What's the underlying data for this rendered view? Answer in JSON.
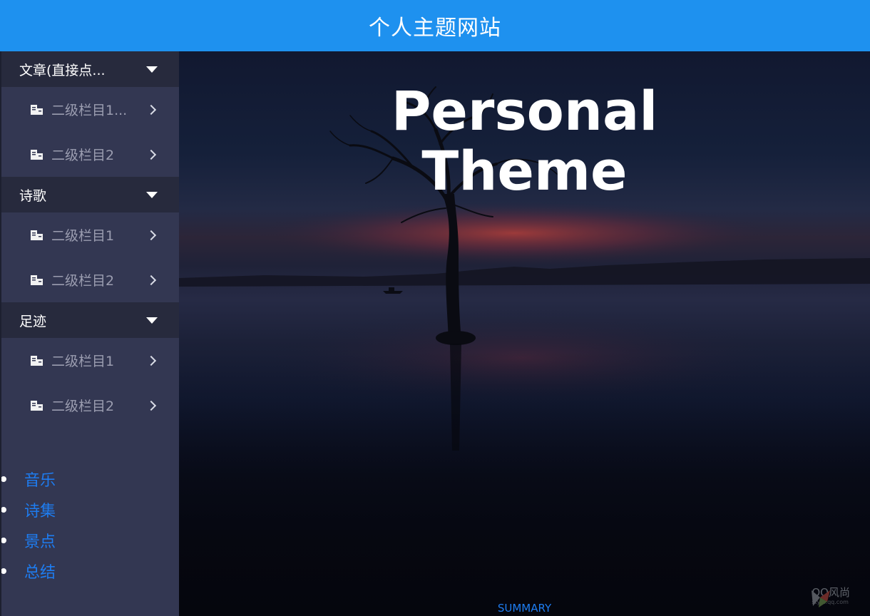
{
  "header": {
    "title": "个人主题网站"
  },
  "sidebar": {
    "sections": [
      {
        "label": "文章(直接点...",
        "items": [
          {
            "label": "二级栏目1..."
          },
          {
            "label": "二级栏目2"
          }
        ]
      },
      {
        "label": "诗歌",
        "items": [
          {
            "label": "二级栏目1"
          },
          {
            "label": "二级栏目2"
          }
        ]
      },
      {
        "label": "足迹",
        "items": [
          {
            "label": "二级栏目1"
          },
          {
            "label": "二级栏目2"
          }
        ]
      }
    ],
    "links": [
      {
        "label": "音乐"
      },
      {
        "label": "诗集"
      },
      {
        "label": "景点"
      },
      {
        "label": "总结"
      }
    ]
  },
  "hero": {
    "title_line1": "Personal",
    "title_line2": "Theme",
    "summary_link": "SUMMARY"
  },
  "watermark": {
    "text": "QQ风尚",
    "subtext": "style.qq.com"
  },
  "icons": {
    "section_toggle": "caret-down-icon",
    "sub_item": "document-icon",
    "sub_item_arrow": "chevron-right-icon"
  },
  "colors": {
    "header_bg": "#1e91ef",
    "sidebar_bg": "#333752",
    "section_bg": "#272a3d",
    "link": "#1e7cf0"
  }
}
